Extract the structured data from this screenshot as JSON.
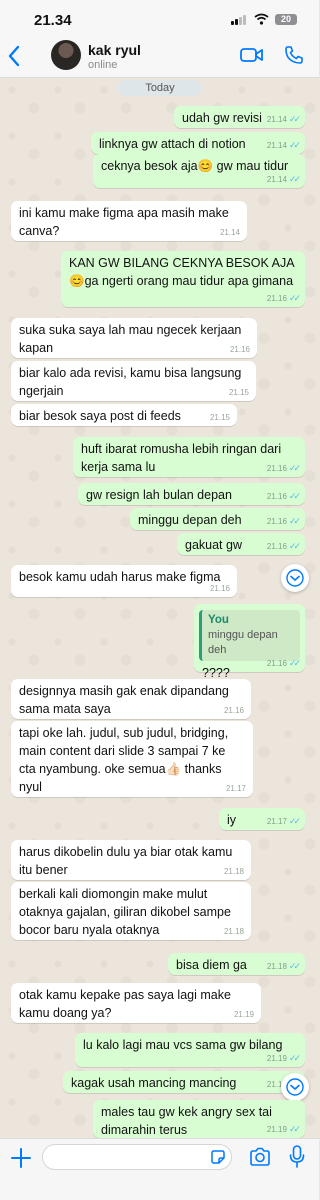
{
  "status_bar": {
    "time": "21.34",
    "battery": "20"
  },
  "header": {
    "contact_name": "kak ryul",
    "contact_status": "online"
  },
  "chat": {
    "date_label": "Today",
    "messages": [
      {
        "dir": "out",
        "text": "udah gw revisi",
        "time": "21.14",
        "ticks": "✓✓"
      },
      {
        "dir": "out",
        "text": "linknya gw attach di notion",
        "time": "21.14",
        "ticks": "✓✓"
      },
      {
        "dir": "out",
        "text": "ceknya besok aja😊 gw mau tidur",
        "time": "21.14",
        "ticks": "✓✓"
      },
      {
        "dir": "in",
        "text": "ini kamu make figma apa masih make canva?",
        "time": "21.14"
      },
      {
        "dir": "out",
        "text": "KAN GW BILANG CEKNYA BESOK AJA 😊ga ngerti orang mau tidur apa gimana",
        "time": "21.16",
        "ticks": "✓✓"
      },
      {
        "dir": "in",
        "text": "suka suka saya lah mau ngecek kerjaan kapan",
        "time": "21.16"
      },
      {
        "dir": "in",
        "text": "biar kalo ada revisi, kamu bisa langsung ngerjain",
        "time": "21.15"
      },
      {
        "dir": "in",
        "text": "biar besok saya post di feeds",
        "time": "21.15"
      },
      {
        "dir": "out",
        "text": "huft ibarat romusha lebih ringan dari kerja sama lu",
        "time": "21.16",
        "ticks": "✓✓"
      },
      {
        "dir": "out",
        "text": "gw resign lah bulan depan",
        "time": "21.16",
        "ticks": "✓✓"
      },
      {
        "dir": "out",
        "text": "minggu depan deh",
        "time": "21.16",
        "ticks": "✓✓"
      },
      {
        "dir": "out",
        "text": "gakuat gw",
        "time": "21.16",
        "ticks": "✓✓"
      },
      {
        "dir": "in",
        "text": "besok kamu udah harus make figma",
        "time": "21.16"
      },
      {
        "dir": "out",
        "quote_author": "You",
        "quote_text": "minggu depan deh",
        "text": "????",
        "time": "21.16",
        "ticks": "✓✓"
      },
      {
        "dir": "in",
        "text": "designnya masih gak enak dipandang sama mata saya",
        "time": "21.16"
      },
      {
        "dir": "in",
        "text": "tapi oke lah. judul, sub judul, bridging, main content dari slide 3 sampai 7 ke cta nyambung. oke semua👍🏻 thanks nyul",
        "time": "21.17"
      },
      {
        "dir": "out",
        "text": "iy",
        "time": "21.17",
        "ticks": "✓✓"
      },
      {
        "dir": "in",
        "text": "harus dikobelin dulu ya biar otak kamu itu bener",
        "time": "21.18"
      },
      {
        "dir": "in",
        "text": "berkali kali diomongin make mulut otaknya gajalan, giliran dikobel sampe bocor baru nyala otaknya",
        "time": "21.18"
      },
      {
        "dir": "out",
        "text": "bisa diem ga",
        "time": "21.18",
        "ticks": "✓✓"
      },
      {
        "dir": "in",
        "text": "otak kamu kepake pas saya lagi make kamu doang ya?",
        "time": "21.19"
      },
      {
        "dir": "out",
        "text": "lu kalo lagi mau vcs sama gw bilang",
        "time": "21.19",
        "ticks": "✓✓"
      },
      {
        "dir": "out",
        "text": "kagak usah mancing mancing",
        "time": "21.19",
        "ticks": "✓✓"
      },
      {
        "dir": "out",
        "text": "males tau gw kek angry sex tai dimarahin terus",
        "time": "21.19",
        "ticks": "✓✓"
      }
    ]
  },
  "input": {
    "placeholder": ""
  },
  "icons": {
    "back": "chevron-left-icon",
    "video": "video-call-icon",
    "call": "phone-icon",
    "plus": "plus-icon",
    "sticker": "sticker-icon",
    "camera": "camera-icon",
    "mic": "microphone-icon",
    "scroll_down": "chevron-down-icon"
  },
  "colors": {
    "accent": "#007aff",
    "outgoing_bubble": "#d9fdd3",
    "incoming_bubble": "#ffffff",
    "read_ticks": "#53bdeb",
    "quote_author": "#1a8a6a"
  }
}
